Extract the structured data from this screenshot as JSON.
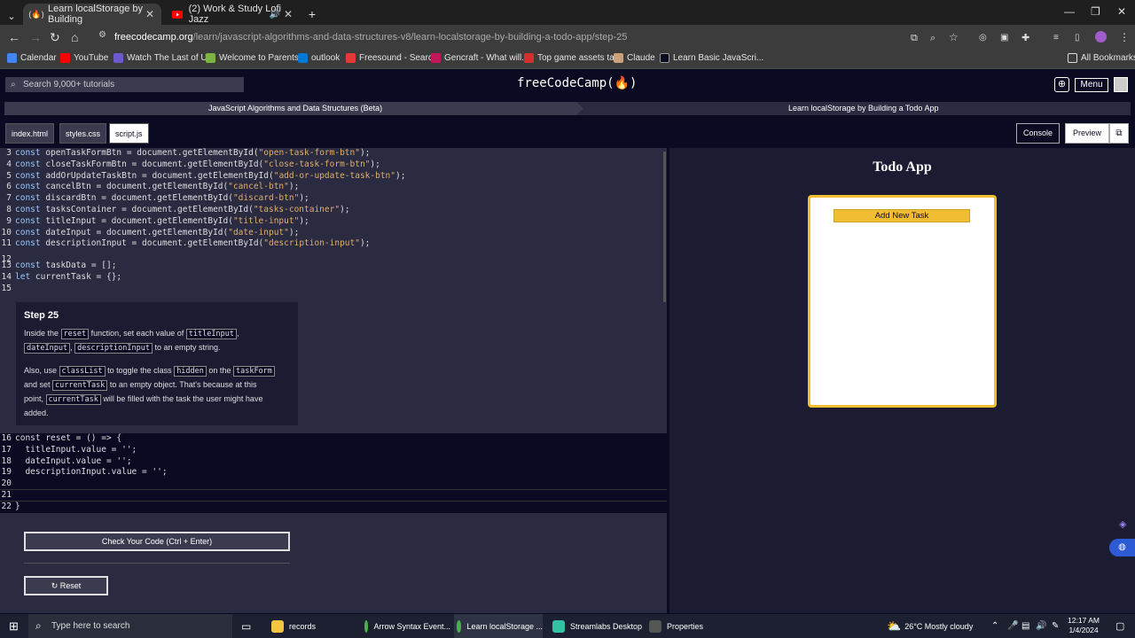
{
  "browser": {
    "tabs": [
      {
        "title": "Learn localStorage by Building",
        "active": true
      },
      {
        "title": "(2) Work & Study Lofi Jazz",
        "active": false
      }
    ],
    "new_tab": "+",
    "url_domain": "freecodecamp.org",
    "url_path": "/learn/javascript-algorithms-and-data-structures-v8/learn-localstorage-by-building-a-todo-app/step-25",
    "bookmarks": [
      "Calendar",
      "YouTube",
      "Watch The Last of U...",
      "Welcome to Parents...",
      "outlook",
      "Freesound - Search",
      "Gencraft - What will...",
      "Top game assets ta...",
      "Claude",
      "Learn Basic JavaScri..."
    ],
    "all_bookmarks": "All Bookmarks"
  },
  "fcc": {
    "search_placeholder": "Search 9,000+ tutorials",
    "logo": "freeCodeCamp(🔥)",
    "menu": "Menu",
    "breadcrumb_left": "JavaScript Algorithms and Data Structures (Beta)",
    "breadcrumb_right": "Learn localStorage by Building a Todo App",
    "files": [
      "index.html",
      "styles.css",
      "script.js"
    ],
    "console": "Console",
    "preview": "Preview"
  },
  "code_top": [
    {
      "n": "3",
      "name": "openTaskFormBtn",
      "id": "open-task-form-btn"
    },
    {
      "n": "4",
      "name": "closeTaskFormBtn",
      "id": "close-task-form-btn"
    },
    {
      "n": "5",
      "name": "addOrUpdateTaskBtn",
      "id": "add-or-update-task-btn"
    },
    {
      "n": "6",
      "name": "cancelBtn",
      "id": "cancel-btn"
    },
    {
      "n": "7",
      "name": "discardBtn",
      "id": "discard-btn"
    },
    {
      "n": "8",
      "name": "tasksContainer",
      "id": "tasks-container"
    },
    {
      "n": "9",
      "name": "titleInput",
      "id": "title-input"
    },
    {
      "n": "10",
      "name": "dateInput",
      "id": "date-input"
    },
    {
      "n": "11",
      "name": "descriptionInput",
      "id": "description-input"
    }
  ],
  "code_mid": {
    "l12": "12",
    "l13": "13",
    "l13_text": "taskData = [];",
    "l14": "14",
    "l14_text": "currentTask = {};",
    "l15": "15"
  },
  "step": {
    "title": "Step 25",
    "p1_a": "Inside the",
    "p1_code1": "reset",
    "p1_b": "function, set each value of",
    "p1_code2": "titleInput",
    "p1_c": ",",
    "p1_code3": "dateInput",
    "p1_d": ",",
    "p1_code4": "descriptionInput",
    "p1_e": "to an empty string.",
    "p2_a": "Also, use",
    "p2_code1": "classList",
    "p2_b": "to toggle the class",
    "p2_code2": "hidden",
    "p2_c": "on the",
    "p2_code3": "taskForm",
    "p2_d": "and set",
    "p2_code4": "currentTask",
    "p2_e": "to an empty object. That's because at this",
    "p2_f": "point,",
    "p2_code5": "currentTask",
    "p2_g": "will be filled with the task the user might have",
    "p2_h": "added."
  },
  "code_edit": [
    {
      "n": "16",
      "text": "const reset = () => {"
    },
    {
      "n": "17",
      "text": "  titleInput.value = '';"
    },
    {
      "n": "18",
      "text": "  dateInput.value = '';"
    },
    {
      "n": "19",
      "text": "  descriptionInput.value = '';"
    },
    {
      "n": "20",
      "text": ""
    },
    {
      "n": "21",
      "text": ""
    },
    {
      "n": "22",
      "text": "}"
    }
  ],
  "buttons": {
    "check": "Check Your Code (Ctrl + Enter)",
    "reset": "Reset"
  },
  "preview_app": {
    "title": "Todo App",
    "add_task": "Add New Task"
  },
  "taskbar": {
    "search": "Type here to search",
    "apps": [
      "records",
      "Arrow Syntax Event...",
      "Learn localStorage ...",
      "Streamlabs Desktop",
      "Properties"
    ],
    "weather": "26°C  Mostly cloudy",
    "time": "12:17 AM",
    "date": "1/4/2024"
  },
  "colors": {
    "fcc_dark": "#0a0a23",
    "fcc_yellow": "#f1be32",
    "editor_bg": "#2a2a40"
  }
}
